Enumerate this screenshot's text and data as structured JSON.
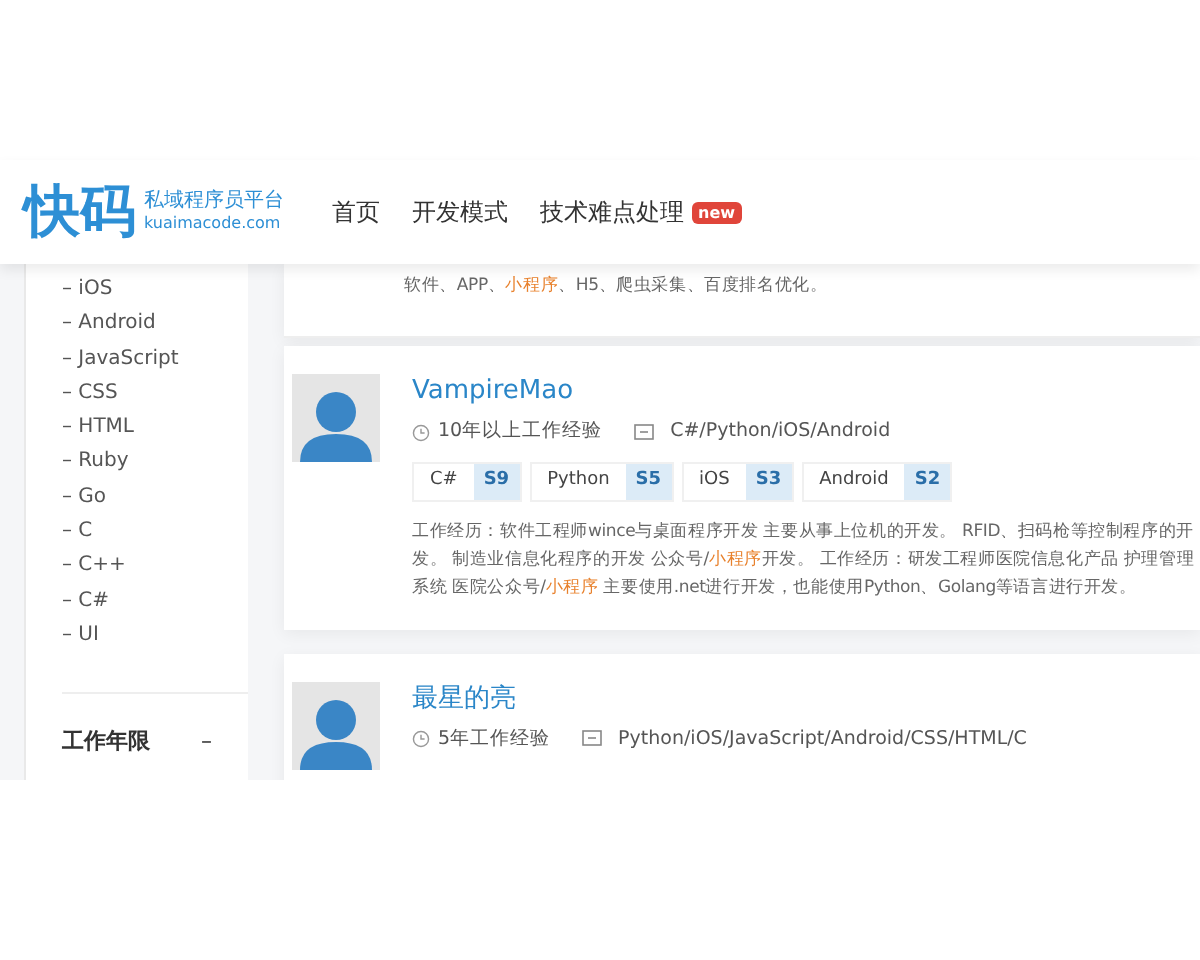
{
  "header": {
    "logo": {
      "mark": "快码",
      "tagline": "私域程序员平台",
      "domain": "kuaimacode.com"
    },
    "nav": [
      {
        "label": "首页"
      },
      {
        "label": "开发模式"
      },
      {
        "label": "技术难点处理",
        "badge": "new"
      }
    ]
  },
  "sidebar": {
    "items": [
      "– iOS",
      "– Android",
      "– JavaScript",
      "– CSS",
      "– HTML",
      "– Ruby",
      "– Go",
      "– C",
      "– C++",
      "– C#",
      "– UI"
    ],
    "sections": [
      {
        "title": "工作年限",
        "toggle": "–"
      }
    ]
  },
  "developers": [
    {
      "description": [
        {
          "text": "软件、APP、",
          "highlight": false
        },
        {
          "text": "小程序",
          "highlight": true
        },
        {
          "text": "、H5、爬虫采集、百度排名优化。",
          "highlight": false
        }
      ]
    },
    {
      "name": "VampireMao",
      "experience": "10年以上工作经验",
      "stack": "C#/Python/iOS/Android",
      "tags": [
        {
          "name": "C#",
          "score": "S9"
        },
        {
          "name": "Python",
          "score": "S5"
        },
        {
          "name": "iOS",
          "score": "S3"
        },
        {
          "name": "Android",
          "score": "S2"
        }
      ],
      "description": [
        {
          "text": "工作经历：软件工程师wince与桌面程序开发 主要从事上位机的开发。 RFID、扫码枪等控制程序的开发。 制造业信息化程序的开发 公众号/",
          "highlight": false
        },
        {
          "text": "小程序",
          "highlight": true
        },
        {
          "text": "开发。 工作经历：研发工程师医院信息化产品 护理管理系统 医院公众号/",
          "highlight": false
        },
        {
          "text": "小程序",
          "highlight": true
        },
        {
          "text": " 主要使用.net进行开发，也能使用Python、Golang等语言进行开发。",
          "highlight": false
        }
      ]
    },
    {
      "name": "最星的亮",
      "experience": "5年工作经验",
      "stack": "Python/iOS/JavaScript/Android/CSS/HTML/C"
    }
  ]
}
